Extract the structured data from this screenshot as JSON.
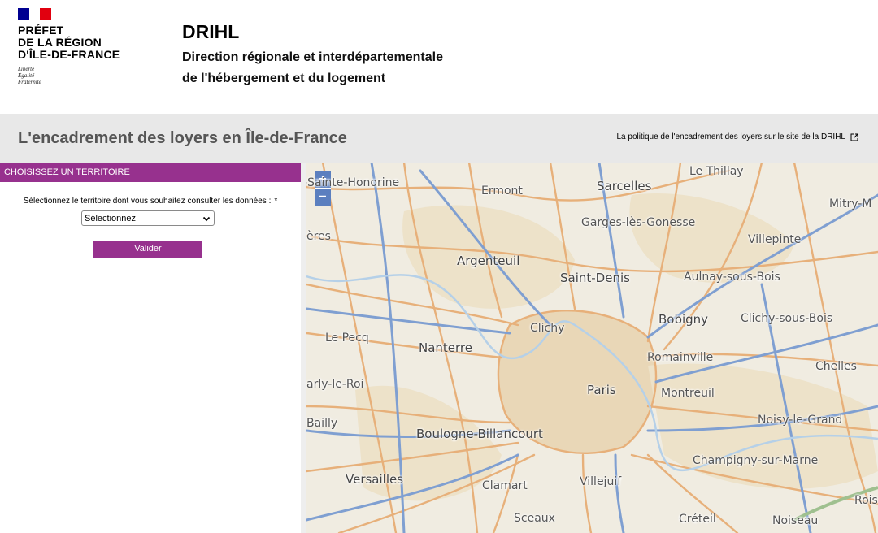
{
  "header": {
    "logo_lines": "PRÉFET\nDE LA RÉGION\nD'ÎLE-DE-FRANCE",
    "motto": "Liberté\nÉgalité\nFraternité",
    "title": "DRIHL",
    "subtitle": "Direction régionale et interdépartementale\nde l'hébergement et du logement",
    "flag_colors": [
      "#000091",
      "#ffffff",
      "#e1000f"
    ]
  },
  "banner": {
    "title": "L'encadrement des loyers en Île-de-France",
    "link_label": "La politique de l'encadrement des loyers sur le site de la DRIHL"
  },
  "panel": {
    "heading": "CHOISISSEZ UN TERRITOIRE",
    "select_label": "Sélectionnez le territoire dont vous souhaitez consulter les données :",
    "required_mark": "*",
    "select_value": "Sélectionnez",
    "validate_label": "Valider",
    "accent_color": "#97318e"
  },
  "map": {
    "zoom_in": "+",
    "zoom_out": "−",
    "places": {
      "le_thillay": "Le Thillay",
      "sainte_honorine": "-Sainte-Honorine",
      "ermont": "Ermont",
      "sarcelles": "Sarcelles",
      "mitry": "Mitry-M",
      "garges": "Garges-lès-Gonesse",
      "eres": "ères",
      "villepinte": "Villepinte",
      "argenteuil": "Argenteuil",
      "saint_denis": "Saint-Denis",
      "aulnay": "Aulnay-sous-Bois",
      "bobigny": "Bobigny",
      "clichy_sous_bois": "Clichy-sous-Bois",
      "le_pecq": "Le Pecq",
      "clichy": "Clichy",
      "nanterre": "Nanterre",
      "romainville": "Romainville",
      "chelles": "Chelles",
      "marly": "arly-le-Roi",
      "paris": "Paris",
      "montreuil": "Montreuil",
      "bailly": "Bailly",
      "noisy": "Noisy-le-Grand",
      "boulogne": "Boulogne-Billancourt",
      "champigny": "Champigny-sur-Marne",
      "versailles": "Versailles",
      "clamart": "Clamart",
      "villejuif": "Villejuif",
      "rois": "Rois",
      "sceaux": "Sceaux",
      "creteil": "Créteil",
      "noiseau": "Noiseau"
    }
  }
}
